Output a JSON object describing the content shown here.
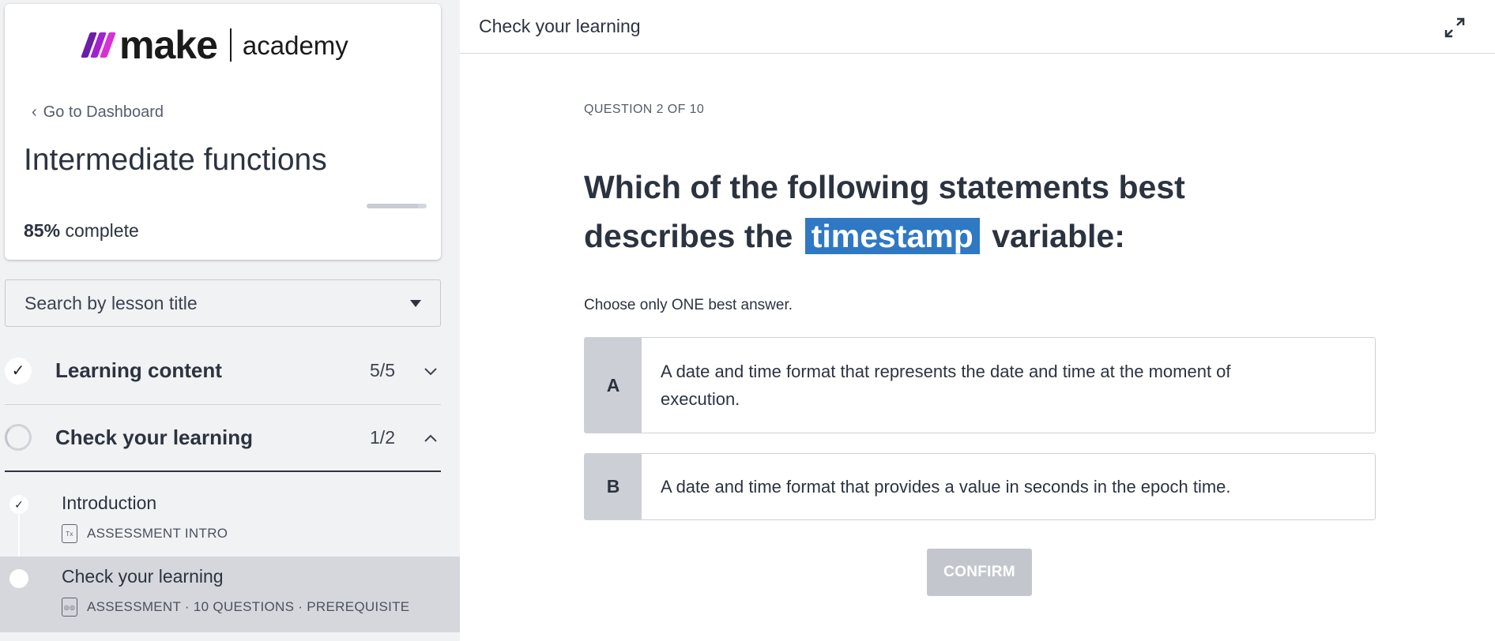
{
  "brand": {
    "wordmark": "make",
    "sub": "academy",
    "mark_colors": [
      "#6b1ea8",
      "#a21fd2",
      "#d82fd8"
    ]
  },
  "sidebar": {
    "back_label": "Go to Dashboard",
    "course_title": "Intermediate functions",
    "progress_percent": 85,
    "progress_value_text": "85%",
    "progress_suffix": "complete",
    "search_placeholder": "Search by lesson title",
    "sections": [
      {
        "title": "Learning content",
        "count": "5/5",
        "status": "complete",
        "expanded": false
      },
      {
        "title": "Check your learning",
        "count": "1/2",
        "status": "in-progress",
        "expanded": true
      }
    ],
    "lessons": [
      {
        "title": "Introduction",
        "meta": "ASSESSMENT INTRO",
        "icon": "document-icon",
        "completed": true
      },
      {
        "title": "Check your learning",
        "meta": "ASSESSMENT · 10 QUESTIONS · PREREQUISITE",
        "icon": "quiz-icon",
        "completed": false,
        "active": true
      }
    ]
  },
  "main": {
    "header_title": "Check your learning",
    "question_number": "QUESTION 2 OF 10",
    "question_prefix": "Which of the following statements best describes the",
    "question_highlight": "timestamp",
    "question_suffix": "variable:",
    "instruction": "Choose only ONE best answer.",
    "options": [
      {
        "letter": "A",
        "text": "A date and time format that represents the date and time at the moment of execution."
      },
      {
        "letter": "B",
        "text": "A date and time format that provides a value in seconds in the epoch time."
      }
    ],
    "confirm_label": "CONFIRM"
  },
  "colors": {
    "highlight": "#2f78c4",
    "confirm_disabled": "#c3c6cc",
    "option_letter_bg": "#cccfd6"
  }
}
